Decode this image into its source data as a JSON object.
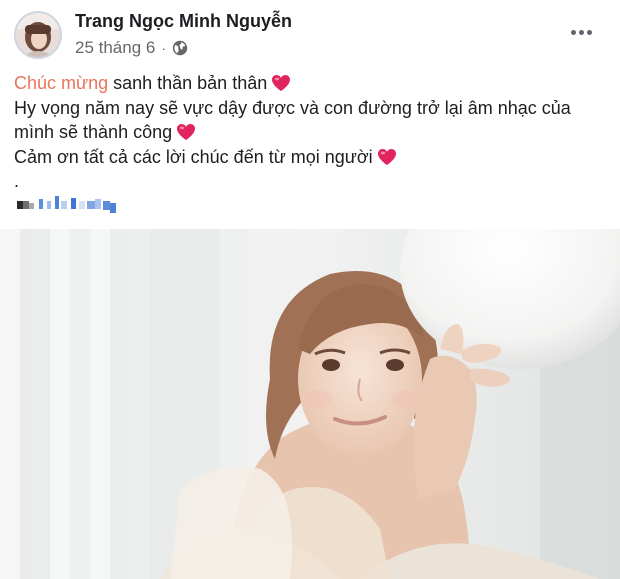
{
  "post": {
    "author": "Trang Ngọc Minh Nguyễn",
    "date": "25 tháng 6",
    "separator": "·",
    "privacy_icon": "globe-icon",
    "more_icon": "more-options-icon",
    "text": {
      "line1_highlight": "Chúc mừng",
      "line1_rest": " sanh thần bản thân",
      "line2": "Hy vọng năm nay sẽ vực dậy được và con đường trở lại âm nhạc của",
      "line3": "mình sẽ thành công",
      "line4": "Cảm ơn tất cả các lời chúc đến từ mọi người",
      "line5": "."
    },
    "emoji": "red-heart",
    "colors": {
      "highlight": "#e8755b",
      "heart": "#e0245e",
      "name": "#1c1e21",
      "meta": "#65676b"
    }
  }
}
